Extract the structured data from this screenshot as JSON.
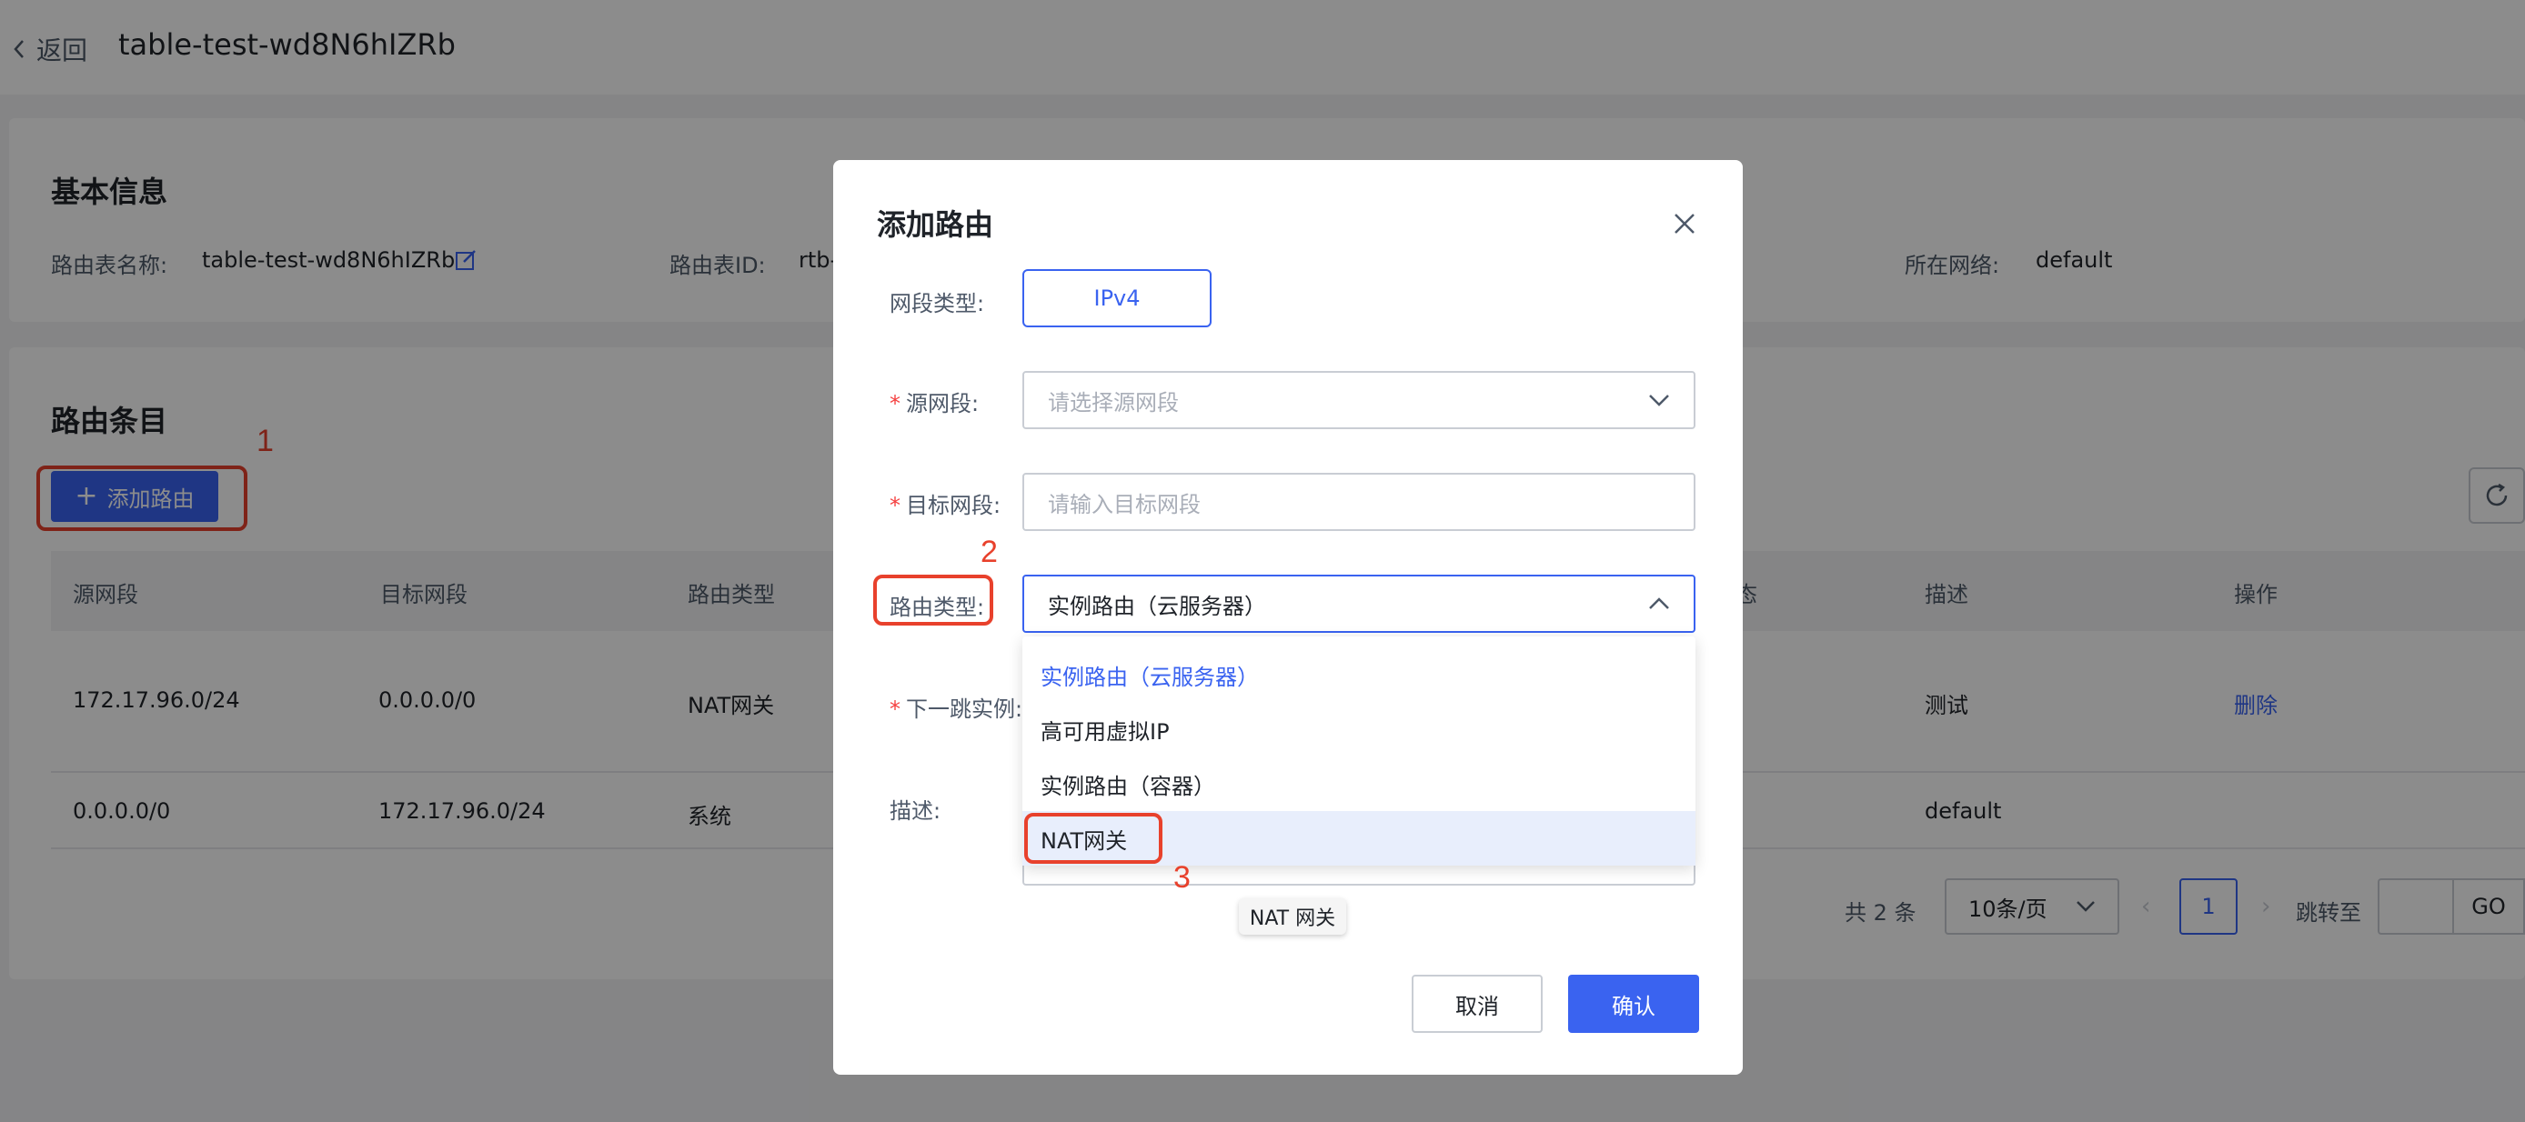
{
  "header": {
    "back_label": "返回",
    "title": "table-test-wd8N6hIZRb"
  },
  "basic_info": {
    "section_title": "基本信息",
    "name_label": "路由表名称:",
    "name_value": "table-test-wd8N6hIZRb",
    "id_label": "路由表ID:",
    "id_value": "rtb-",
    "network_label": "所在网络:",
    "network_value": "default"
  },
  "routes": {
    "section_title": "路由条目",
    "add_button": "添加路由",
    "columns": [
      "源网段",
      "目标网段",
      "路由类型",
      "描述",
      "操作"
    ],
    "hidden_col_fragment": "态",
    "rows": [
      {
        "src": "172.17.96.0/24",
        "dst": "0.0.0.0/0",
        "type": "NAT网关",
        "desc": "测试",
        "action": "删除"
      },
      {
        "src": "0.0.0.0/0",
        "dst": "172.17.96.0/24",
        "type": "系统",
        "desc": "default",
        "action": ""
      }
    ],
    "pager": {
      "total": "共 2 条",
      "page_size": "10条/页",
      "current_page": "1",
      "jump_label": "跳转至",
      "go": "GO"
    }
  },
  "modal": {
    "title": "添加路由",
    "segment_type_label": "网段类型:",
    "segment_type_value": "IPv4",
    "source_label": "源网段:",
    "source_placeholder": "请选择源网段",
    "target_label": "目标网段:",
    "target_placeholder": "请输入目标网段",
    "route_type_label": "路由类型:",
    "route_type_value": "实例路由（云服务器）",
    "next_hop_label": "下一跳实例:",
    "desc_label": "描述:",
    "options": [
      "实例路由（云服务器）",
      "高可用虚拟IP",
      "实例路由（容器）",
      "NAT网关"
    ],
    "tooltip": "NAT 网关",
    "cancel": "取消",
    "confirm": "确认"
  },
  "annotations": {
    "step1": "1",
    "step2": "2",
    "step3": "3"
  },
  "colors": {
    "primary": "#3a63f0",
    "annotation": "#e8412c",
    "required": "#f53f3f"
  }
}
